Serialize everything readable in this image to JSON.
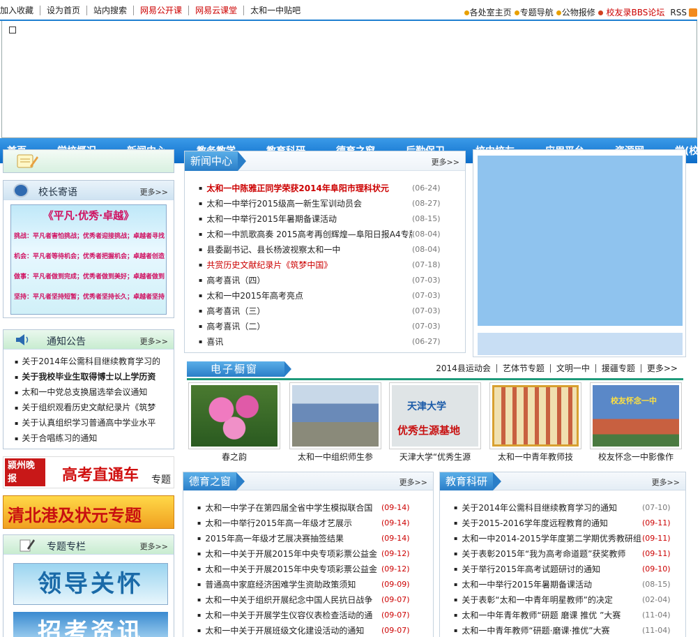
{
  "topbar": {
    "links": [
      {
        "label": "加入收藏",
        "red": false
      },
      {
        "label": "设为首页",
        "red": false
      },
      {
        "label": "站内搜索",
        "red": false
      },
      {
        "label": "网易公开课",
        "red": true
      },
      {
        "label": "网易云课堂",
        "red": true
      },
      {
        "label": "太和一中贴吧",
        "red": false
      }
    ],
    "right": [
      "各处室主页",
      "专题导航",
      "公物报修",
      "校友录BBS论坛"
    ],
    "rss": "RSS"
  },
  "nav": [
    "首页",
    "学校概况",
    "新闻中心",
    "教务教学",
    "教育科研",
    "德育之窗",
    "后勤保卫",
    "校中校友",
    "应用平台",
    "资源网",
    "党(校)务公开"
  ],
  "principal": {
    "title": "校长寄语",
    "more": "更多>>",
    "slogan": "《平凡·优秀·卓越》",
    "lines": [
      "挑战：平凡者害怕挑战；优秀者迎接挑战；卓越者寻找挑战。",
      "机会：平凡者等待机会；优秀者把握机会；卓越者创造机会。",
      "做事：平凡者做到完成；优秀者做到美好；卓越者做到极致。",
      "坚持：平凡者坚持短暂；优秀者坚持长久；卓越者坚持一生。"
    ]
  },
  "notice": {
    "title": "通知公告",
    "more": "更多>>",
    "items": [
      {
        "text": "关于2014年公需科目继续教育学习的",
        "bold": false
      },
      {
        "text": "关于我校毕业生取得博士以上学历资",
        "bold": true
      },
      {
        "text": "太和一中党总支换届选举会议通知",
        "bold": false
      },
      {
        "text": "关于组织观看历史文献纪录片《筑梦",
        "bold": false
      },
      {
        "text": "关于认真组织学习普通高中学业水平",
        "bold": false
      },
      {
        "text": "关于合唱练习的通知",
        "bold": false
      }
    ]
  },
  "promos": {
    "gaokao": {
      "paper": "颍州晚报",
      "main": "高考直通车",
      "suffix": "专题"
    },
    "qingbei": "清北港及状元专题"
  },
  "special": {
    "title": "专题专栏",
    "more": "更多>>",
    "banner1": "领导关怀",
    "banner2": "招考资讯"
  },
  "news": {
    "title": "新闻中心",
    "more": "更多>>",
    "items": [
      {
        "t": "太和一中陈雅正同学荣获2014年阜阳市理科状元",
        "d": "(06-24)",
        "style": "bold"
      },
      {
        "t": "太和一中举行2015级高一新生军训动员会",
        "d": "(08-27)",
        "style": ""
      },
      {
        "t": "太和一中举行2015年暑期备课活动",
        "d": "(08-15)",
        "style": ""
      },
      {
        "t": "太和一中凯歌高奏 2015高考再创辉煌—阜阳日报A4专版",
        "d": "(08-04)",
        "style": ""
      },
      {
        "t": "县委副书记、县长杨波视察太和一中",
        "d": "(08-04)",
        "style": ""
      },
      {
        "t": "共赏历史文献纪录片《筑梦中国》",
        "d": "(07-18)",
        "style": "red"
      },
      {
        "t": "高考喜讯（四）",
        "d": "(07-03)",
        "style": ""
      },
      {
        "t": "太和一中2015年高考亮点",
        "d": "(07-03)",
        "style": ""
      },
      {
        "t": "高考喜讯（三）",
        "d": "(07-03)",
        "style": ""
      },
      {
        "t": "高考喜讯（二）",
        "d": "(07-03)",
        "style": ""
      },
      {
        "t": "喜讯",
        "d": "(06-27)",
        "style": ""
      }
    ]
  },
  "ewindow": {
    "title": "电子橱窗",
    "links": [
      "2014县运动会",
      "艺体节专题",
      "文明一中",
      "援疆专题",
      "更多>>"
    ],
    "thumbs": [
      {
        "caption": "春之韵",
        "color": "#d2589a"
      },
      {
        "caption": "太和一中组织师生参",
        "color": "#6a8ab8"
      },
      {
        "caption": "天津大学“优秀生源",
        "color": "#d8dde0",
        "label": "优秀生源基地",
        "school": "天津大学"
      },
      {
        "caption": "太和一中青年教师技",
        "color": "#e8c060"
      },
      {
        "caption": "校友怀念一中影像作",
        "color": "#4a78b8",
        "label": "校友怀念一中"
      }
    ]
  },
  "moral": {
    "title": "德育之窗",
    "more": "更多>>",
    "items": [
      {
        "t": "太和一中学子在第四届全省中学生模拟联合国",
        "d": "(09-14)",
        "red": true
      },
      {
        "t": "太和一中举行2015年高一年级才艺展示",
        "d": "(09-14)",
        "red": true
      },
      {
        "t": "2015年高一年级才艺展决赛抽签结果",
        "d": "(09-14)",
        "red": true
      },
      {
        "t": "太和一中关于开展2015年中央专项彩票公益金",
        "d": "(09-12)",
        "red": true
      },
      {
        "t": "太和一中关于开展2015年中央专项彩票公益金",
        "d": "(09-12)",
        "red": true
      },
      {
        "t": "普通高中家庭经济困难学生资助政策须知",
        "d": "(09-09)",
        "red": true
      },
      {
        "t": "太和一中关于组织开展纪念中国人民抗日战争",
        "d": "(09-07)",
        "red": true
      },
      {
        "t": "太和一中关于开展学生仪容仪表检查活动的通",
        "d": "(09-07)",
        "red": true
      },
      {
        "t": "太和一中关于开展班级文化建设活动的通知",
        "d": "(09-07)",
        "red": true
      }
    ]
  },
  "research": {
    "title": "教育科研",
    "more": "更多>>",
    "items": [
      {
        "t": "关于2014年公需科目继续教育学习的通知",
        "d": "(07-10)",
        "red": false
      },
      {
        "t": "关于2015-2016学年度远程教育的通知",
        "d": "(09-11)",
        "red": true
      },
      {
        "t": "太和一中2014-2015学年度第二学期优秀教研组",
        "d": "(09-11)",
        "red": true
      },
      {
        "t": "关于表彰2015年“我为高考命道题”获奖教师",
        "d": "(09-11)",
        "red": true
      },
      {
        "t": "关于举行2015年高考试题研讨的通知",
        "d": "(09-10)",
        "red": true
      },
      {
        "t": "太和一中举行2015年暑期备课活动",
        "d": "(08-15)",
        "red": false
      },
      {
        "t": "关于表彰“太和一中青年明星教师”的决定",
        "d": "(02-04)",
        "red": false
      },
      {
        "t": "太和一中年青年教师“研题 磨课 推优 ”大赛",
        "d": "(11-04)",
        "red": false
      },
      {
        "t": "太和一中青年教师“研题·磨课·推优”大赛",
        "d": "(11-04)",
        "red": false
      }
    ]
  }
}
